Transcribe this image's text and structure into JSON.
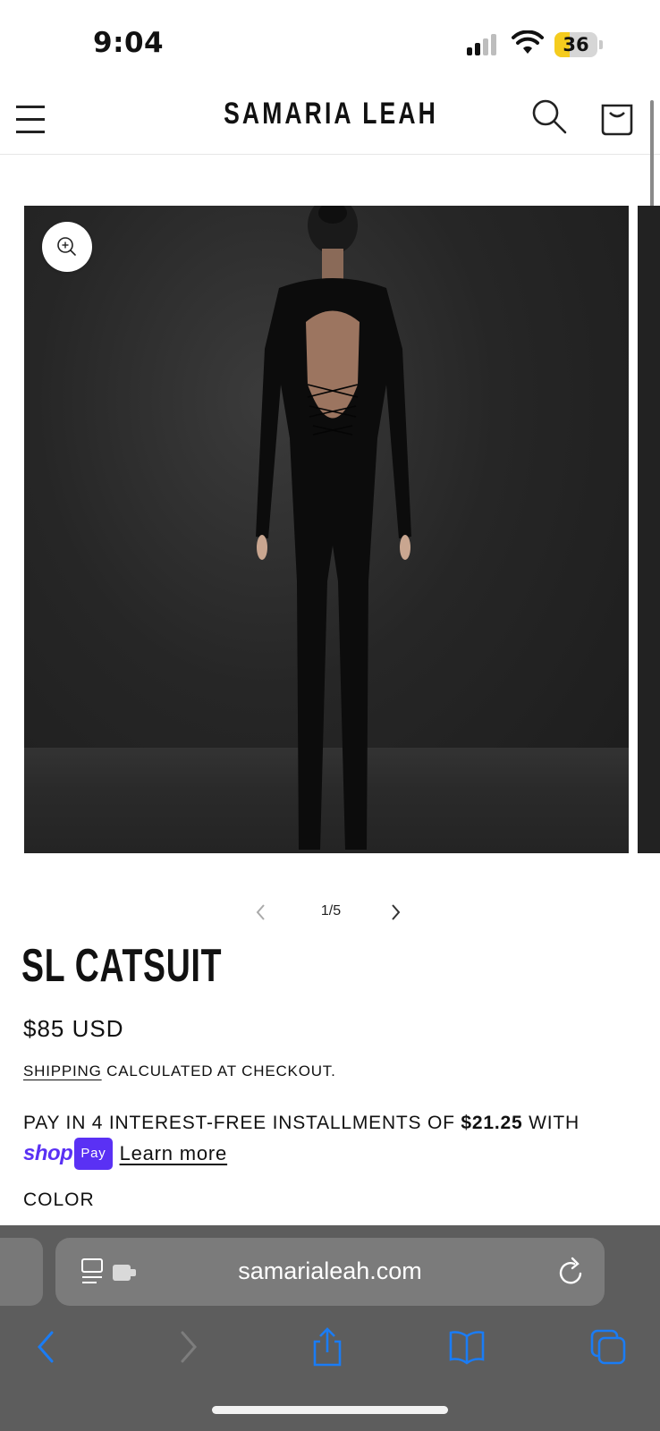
{
  "status_bar": {
    "time": "9:04",
    "battery": "36",
    "battery_level": 0.36
  },
  "header": {
    "brand": "SAMARIA LEAH"
  },
  "gallery": {
    "counter": "1/5"
  },
  "product": {
    "title": "SL CATSUIT",
    "price": "$85 USD",
    "shipping_link": "SHIPPING",
    "shipping_rest": " CALCULATED AT CHECKOUT.",
    "installments_prefix": "PAY IN 4 INTEREST-FREE INSTALLMENTS OF ",
    "installment_amount": "$21.25",
    "installments_suffix": " WITH",
    "shop_logo": "shop",
    "pay_badge": "Pay",
    "learn_more": "Learn more",
    "color_label": "COLOR"
  },
  "safari": {
    "url": "samarialeah.com"
  },
  "colors": {
    "safari_bar": "#5d5d5d",
    "url_field": "#7b7b7b",
    "shop_purple": "#5a31f4",
    "battery_yellow": "#f5cc1e",
    "toolbar_blue": "#1a7cf5"
  }
}
